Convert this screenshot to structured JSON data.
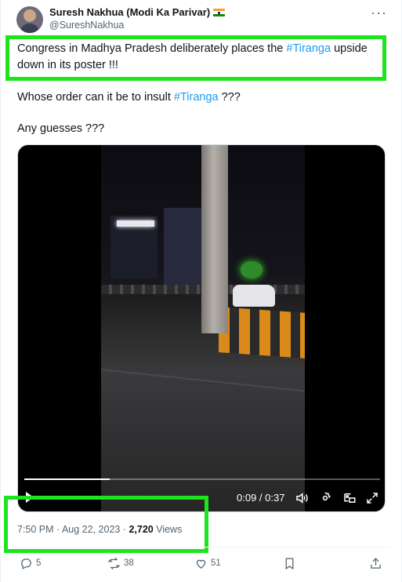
{
  "author": {
    "name": "Suresh Nakhua (Modi Ka Parivar)",
    "handle": "@SureshNakhua"
  },
  "tweet": {
    "line1_prefix": "Congress in Madhya Pradesh deliberately places the ",
    "line1_hashtag": "#Tiranga",
    "line1_suffix": " upside",
    "line2": "down in its poster !!!",
    "line3_prefix": "Whose order can it be to insult ",
    "line3_hashtag": "#Tiranga",
    "line3_suffix": " ???",
    "line4": "Any guesses ???"
  },
  "video": {
    "time_display": "0:09 / 0:37",
    "progress_fraction": 0.24
  },
  "meta": {
    "timestamp": "7:50 PM · Aug 22, 2023 · ",
    "views_count": "2,720",
    "views_label": " Views"
  },
  "actions": {
    "replies": "5",
    "reposts": "38",
    "likes": "51"
  },
  "colors": {
    "highlight": "#1ee41e",
    "hashtag": "#1d9bf0",
    "muted": "#536471"
  },
  "icons": [
    "more-icon",
    "play-icon",
    "volume-icon",
    "settings-icon",
    "pip-icon",
    "fullscreen-icon",
    "reply-icon",
    "repost-icon",
    "like-icon",
    "bookmark-icon",
    "share-icon"
  ]
}
